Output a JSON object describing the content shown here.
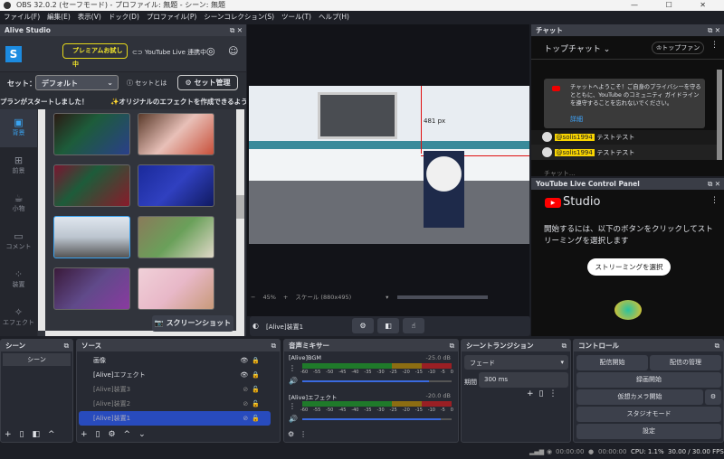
{
  "window": {
    "title": "OBS 32.0.2 (セーフモード) - プロファイル: 無題 - シーン: 無題",
    "controls": "— ☐ ✕"
  },
  "menu": [
    "ファイル(F)",
    "編集(E)",
    "表示(V)",
    "ドック(D)",
    "プロファイル(P)",
    "シーンコレクション(S)",
    "ツール(T)",
    "ヘルプ(H)"
  ],
  "alive": {
    "title": "Alive Studio",
    "logo": "S",
    "premium": "プレミアムお試し中",
    "youtube_link": "YouTube Live",
    "youtube_status": "連携中",
    "set_label": "セット：",
    "set_value": "デフォルト",
    "set_info": "セットとは",
    "set_manage": "セット管理",
    "banner_left": "プランがスタートしました！",
    "banner_right": "✨オリジナルのエフェクトを作成できるよう",
    "sidebar": [
      {
        "icon": "▣",
        "label": "背景"
      },
      {
        "icon": "⊞",
        "label": "前景"
      },
      {
        "icon": "☕",
        "label": "小物"
      },
      {
        "icon": "▭",
        "label": "コメント"
      },
      {
        "icon": "⁘",
        "label": "装置"
      },
      {
        "icon": "✧",
        "label": "エフェクト"
      }
    ],
    "screenshot": "スクリーンショット"
  },
  "preview": {
    "measure": "481 px",
    "zoom": "45%",
    "scale": "スケール (880x495)",
    "source": "[Alive]装置1"
  },
  "chat": {
    "title": "チャット",
    "mode": "トップチャット",
    "top_fan": "トップファン",
    "notice": "チャットへようこそ！ご自身のプライバシーを守るとともに、YouTube のコミュニティ ガイドラインを遵守することを忘れないでください。",
    "details": "詳細",
    "messages": [
      {
        "user": "@solis1994",
        "text": "テストテスト"
      },
      {
        "user": "@solis1994",
        "text": "テストテスト"
      }
    ],
    "placeholder": "チャット..."
  },
  "ytpanel": {
    "title": "YouTube Live Control Panel",
    "studio": "Studio",
    "message": "開始するには、以下のボタンをクリックしてストリーミングを選択します",
    "button": "ストリーミングを選択"
  },
  "scenes": {
    "title": "シーン",
    "items": [
      "シーン"
    ]
  },
  "sources": {
    "title": "ソース",
    "items": [
      {
        "name": "画像",
        "visible": true
      },
      {
        "name": "[Alive]エフェクト",
        "visible": true
      },
      {
        "name": "[Alive]装置3",
        "visible": false
      },
      {
        "name": "[Alive]装置2",
        "visible": false
      },
      {
        "name": "[Alive]装置1",
        "visible": false,
        "selected": true
      }
    ]
  },
  "mixer": {
    "title": "音声ミキサー",
    "channels": [
      {
        "name": "[Alive]BGM",
        "db": "-25.0 dB",
        "volume": 0.85
      },
      {
        "name": "[Alive]エフェクト",
        "db": "-20.0 dB",
        "volume": 0.93
      }
    ],
    "ticks": [
      "-60",
      "-55",
      "-50",
      "-45",
      "-40",
      "-35",
      "-30",
      "-25",
      "-20",
      "-15",
      "-10",
      "-5",
      "0"
    ]
  },
  "transition": {
    "title": "シーントランジション",
    "type": "フェード",
    "duration_label": "期間",
    "duration": "300 ms"
  },
  "controls": {
    "title": "コントロール",
    "start_stream": "配信開始",
    "manage_stream": "配信の管理",
    "start_record": "録画開始",
    "virtual_cam": "仮想カメラ開始",
    "studio_mode": "スタジオモード",
    "settings": "設定"
  },
  "status": {
    "rec_time": "00:00:00",
    "stream_time": "00:00:00",
    "cpu": "CPU: 1.1%",
    "fps": "30.00 / 30.00 FPS"
  }
}
